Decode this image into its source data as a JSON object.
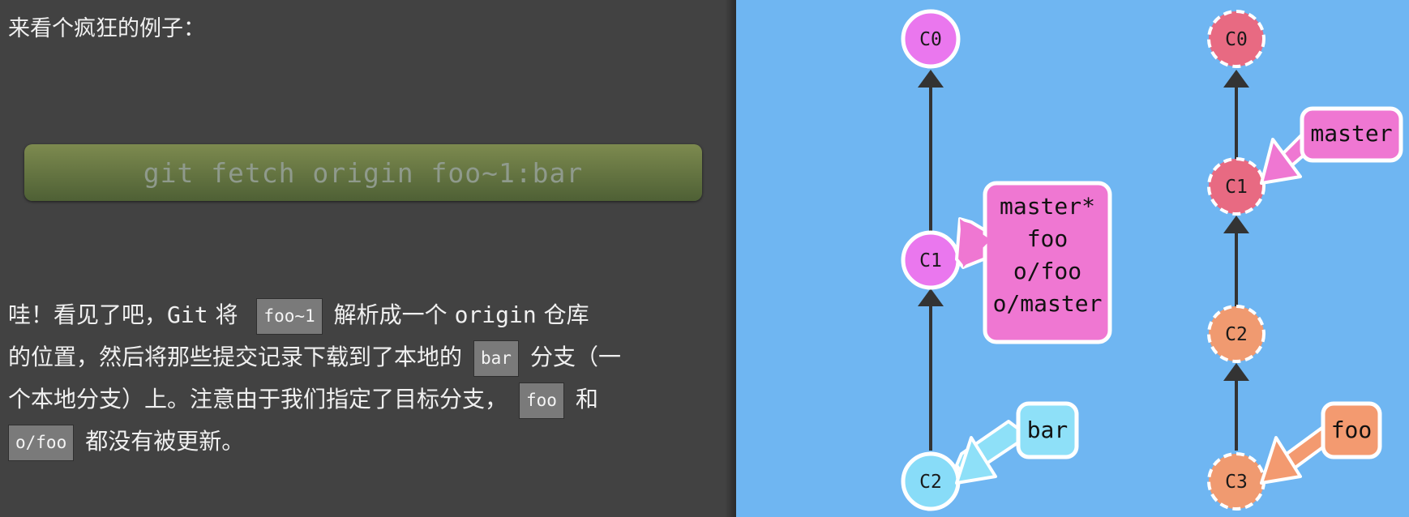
{
  "intro_text": "来看个疯狂的例子：",
  "command": "git fetch origin foo~1:bar",
  "paragraph": {
    "p1": "哇！看见了吧，",
    "git_word": "Git",
    "p2": "将",
    "code1": "foo~1",
    "p3": "解析成一个",
    "origin_word": "origin",
    "p4": "仓库",
    "p5": "的位置，然后将那些提交记录下载到了本地的",
    "code2": "bar",
    "p6": "分支（一",
    "p7": "个本地分支）上。注意由于我们指定了目标分支，",
    "code3": "foo",
    "p8": "和",
    "code4": "o/foo",
    "p9": "都没有被更新。"
  },
  "local_tree": {
    "commits": [
      "C0",
      "C1",
      "C2"
    ],
    "label_master": "master*",
    "label_foo": "foo",
    "label_o_foo": "o/foo",
    "label_o_master": "o/master",
    "label_bar": "bar"
  },
  "remote_tree": {
    "commits": [
      "C0",
      "C1",
      "C2",
      "C3"
    ],
    "label_master": "master",
    "label_foo": "foo"
  },
  "colors": {
    "background_left": "#424242",
    "background_right": "#6fb6f2",
    "local_commit": "#ea77ee",
    "bar_commit": "#88dcf8",
    "remote_commit": "#e86a82",
    "remote_foo_commit": "#f09a70",
    "branch_pink": "#ef77d2",
    "branch_orange": "#f39a70",
    "branch_blue": "#8ee0f8"
  }
}
